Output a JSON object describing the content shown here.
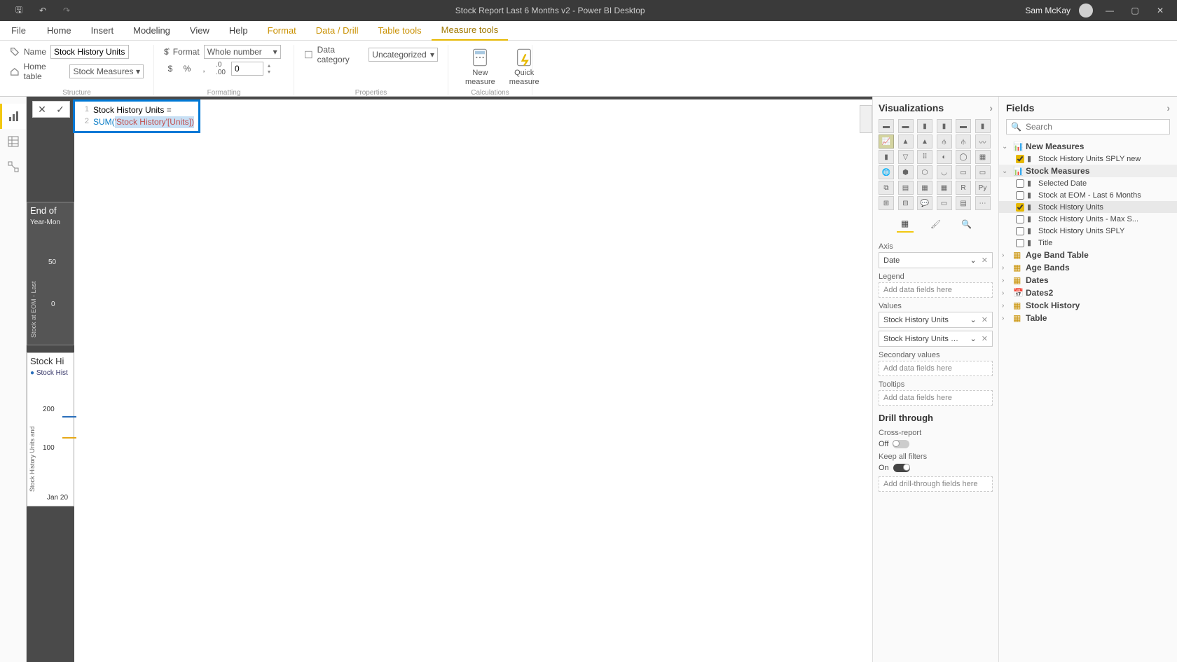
{
  "titlebar": {
    "title": "Stock Report Last 6 Months v2 - Power BI Desktop",
    "user": "Sam McKay"
  },
  "tabs": {
    "file": "File",
    "items": [
      "Home",
      "Insert",
      "Modeling",
      "View",
      "Help",
      "Format",
      "Data / Drill",
      "Table tools",
      "Measure tools"
    ],
    "contextual_start": 5,
    "active": 8
  },
  "ribbon": {
    "structure": {
      "label": "Structure",
      "name_label": "Name",
      "name_value": "Stock History Units",
      "home_label": "Home table",
      "home_value": "Stock Measures"
    },
    "formatting": {
      "label": "Formatting",
      "format_label": "Format",
      "format_value": "Whole number",
      "decimals": "0"
    },
    "properties": {
      "label": "Properties",
      "category_label": "Data category",
      "category_value": "Uncategorized"
    },
    "calculations": {
      "label": "Calculations",
      "new_measure": "New\nmeasure",
      "quick_measure": "Quick\nmeasure"
    }
  },
  "formula": {
    "line1": "Stock History Units =",
    "line2_fn": "SUM(",
    "line2_ref": "'Stock History'[Units])"
  },
  "peek1": {
    "title": "End of",
    "subtitle": "Year-Mon",
    "ylabel": "Stock at EOM - Last",
    "y1": "50",
    "y2": "0"
  },
  "peek2": {
    "title": "Stock Hi",
    "legend": "Stock Hist",
    "ylabel": "Stock History Units and",
    "y1": "200",
    "y2": "100",
    "xlabel": "Jan 20"
  },
  "viz": {
    "title": "Visualizations",
    "axis_label": "Axis",
    "axis_value": "Date",
    "legend_label": "Legend",
    "values_label": "Values",
    "value1": "Stock History Units",
    "value2": "Stock History Units SPLY",
    "secondary_label": "Secondary values",
    "tooltips_label": "Tooltips",
    "placeholder": "Add data fields here",
    "drill_title": "Drill through",
    "cross_label": "Cross-report",
    "off": "Off",
    "keep_label": "Keep all filters",
    "on": "On",
    "drill_placeholder": "Add drill-through fields here"
  },
  "fields": {
    "title": "Fields",
    "search_placeholder": "Search",
    "tables": [
      {
        "name": "New Measures",
        "expanded": true,
        "icon": "measure-table",
        "fields": [
          {
            "name": "Stock History Units SPLY new",
            "checked": true,
            "measure": true
          }
        ]
      },
      {
        "name": "Stock Measures",
        "expanded": true,
        "icon": "measure-table",
        "selected": true,
        "fields": [
          {
            "name": "Selected Date",
            "checked": false,
            "measure": true
          },
          {
            "name": "Stock at EOM - Last 6 Months",
            "checked": false,
            "measure": true
          },
          {
            "name": "Stock History Units",
            "checked": true,
            "measure": true,
            "selected": true
          },
          {
            "name": "Stock History Units - Max S...",
            "checked": false,
            "measure": true
          },
          {
            "name": "Stock History Units SPLY",
            "checked": false,
            "measure": true
          },
          {
            "name": "Title",
            "checked": false,
            "measure": true
          }
        ]
      },
      {
        "name": "Age Band Table",
        "expanded": false,
        "icon": "table"
      },
      {
        "name": "Age Bands",
        "expanded": false,
        "icon": "table"
      },
      {
        "name": "Dates",
        "expanded": false,
        "icon": "table"
      },
      {
        "name": "Dates2",
        "expanded": false,
        "icon": "date-table"
      },
      {
        "name": "Stock History",
        "expanded": false,
        "icon": "table"
      },
      {
        "name": "Table",
        "expanded": false,
        "icon": "table"
      }
    ]
  }
}
